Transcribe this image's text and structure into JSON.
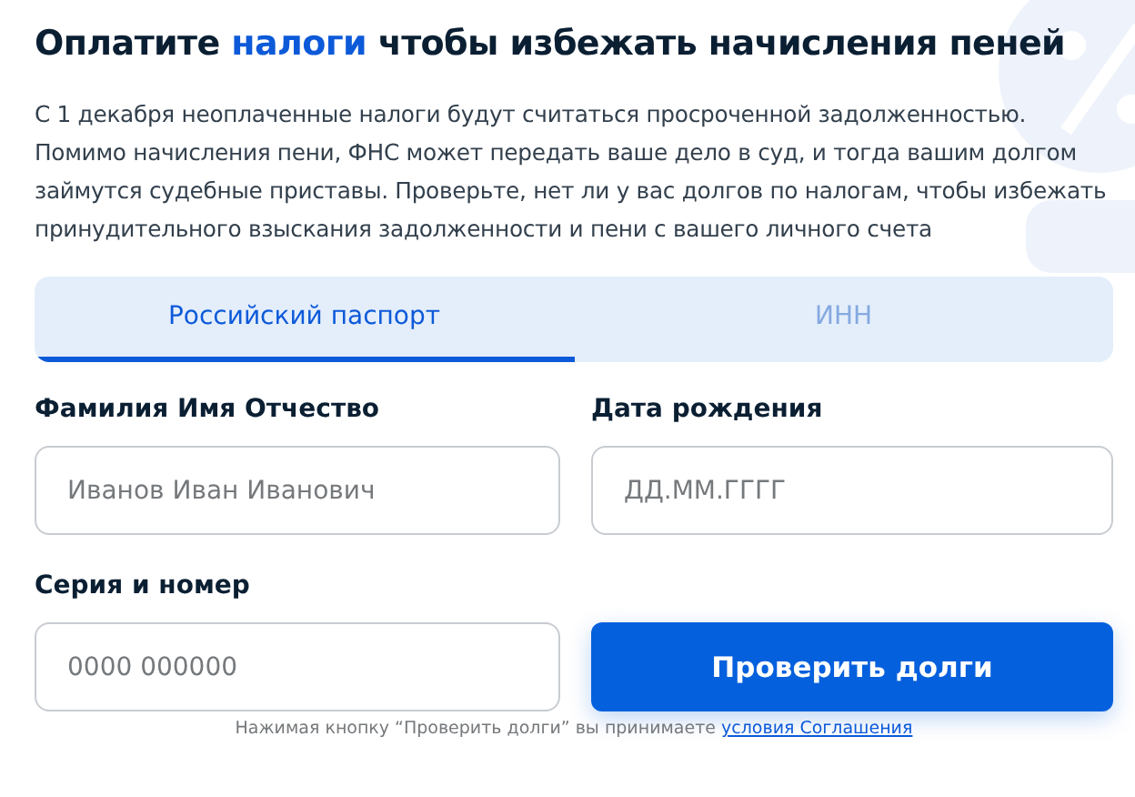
{
  "title": {
    "parts": [
      {
        "text": "Оплатите ",
        "kind": "plain"
      },
      {
        "text": "налоги",
        "kind": "accent"
      },
      {
        "text": " чтобы избежать начисления пеней",
        "kind": "plain"
      }
    ]
  },
  "description": "С 1 декабря неоплаченные налоги будут считаться просроченной задолженностью. Помимо начисления пени, ФНС может передать ваше дело в суд, и тогда вашим долгом займутся судебные приставы. Проверьте, нет ли у вас долгов по налогам, чтобы избежать принудительного взыскания задолженности и пени с вашего личного счета",
  "tabs": [
    {
      "label": "Российский паспорт",
      "selected": true
    },
    {
      "label": "ИНН",
      "selected": false
    }
  ],
  "fields": [
    {
      "label": "Фамилия Имя Отчество",
      "placeholder": "Иванов Иван Иванович"
    },
    {
      "label": "Дата рождения",
      "placeholder": "ДД.ММ.ГГГГ"
    },
    {
      "label": "Серия и номер",
      "placeholder": "0000 000000"
    }
  ],
  "submit_button": "Проверить долги",
  "consent": {
    "text": "Нажимая кнопку “Проверить долги” вы принимаете ",
    "link": "условия Соглашения"
  }
}
